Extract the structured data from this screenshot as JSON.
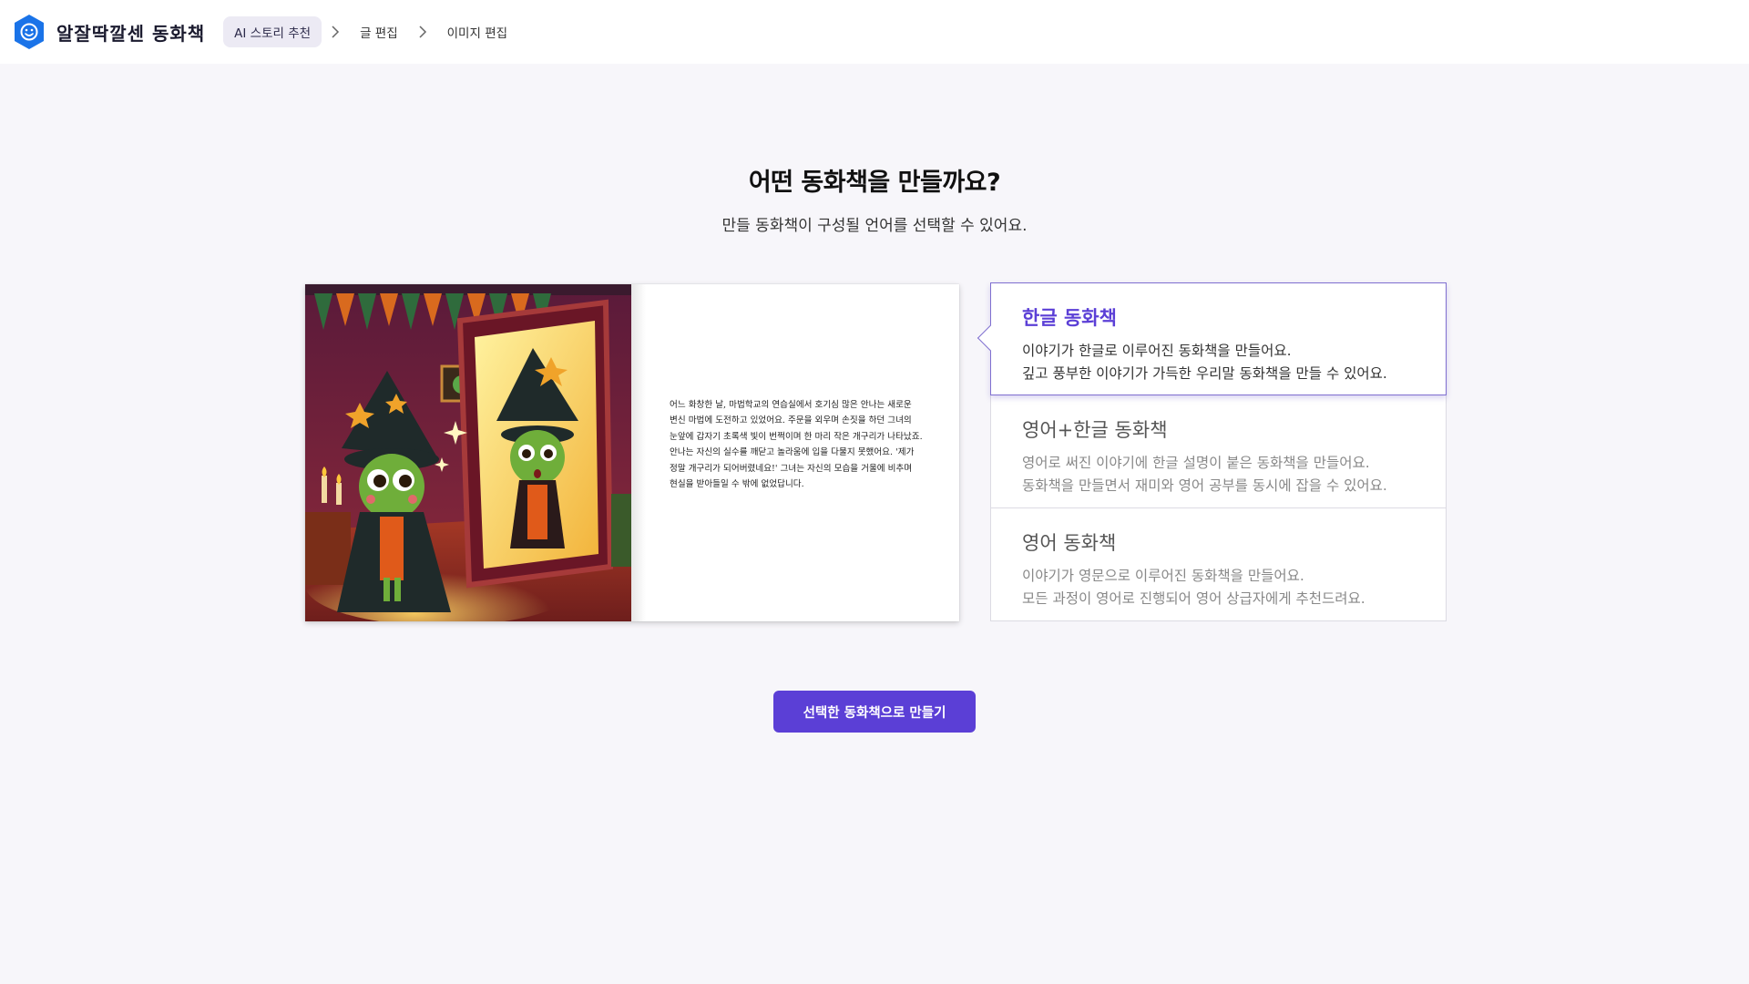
{
  "app": {
    "name": "알잘딱깔센 동화책",
    "logo_icon": "smiley-hexagon-icon",
    "brand_color": "#1a73e8"
  },
  "breadcrumb": [
    {
      "label": "AI 스토리 추천",
      "active": true
    },
    {
      "label": "글 편집",
      "active": false
    },
    {
      "label": "이미지 편집",
      "active": false
    }
  ],
  "heading": {
    "title": "어떤 동화책을 만들까요?",
    "subtitle": "만들 동화책이 구성될 언어를 선택할 수 있어요."
  },
  "preview": {
    "illustration_icon": "frog-witch-mirror-illustration",
    "text": "어느 화창한 날, 마법학교의 연습실에서 호기심 많은 안나는 새로운 변신 마법에 도전하고 있었어요. 주문을 외우며 손짓을 하던 그녀의 눈앞에 갑자기 초록색 빛이 번쩍이며 한 마리 작은 개구리가 나타났죠. 안나는 자신의 실수를 깨닫고 놀라움에 입을 다물지 못했어요. '제가 정말 개구리가 되어버렸네요!' 그녀는 자신의 모습을 거울에 비추며 현실을 받아들일 수 밖에 없었답니다."
  },
  "options": [
    {
      "title": "한글 동화책",
      "desc_line1": "이야기가 한글로 이루어진 동화책을 만들어요.",
      "desc_line2": "깊고 풍부한 이야기가 가득한 우리말 동화책을 만들 수 있어요.",
      "selected": true
    },
    {
      "title": "영어+한글 동화책",
      "desc_line1": "영어로 써진 이야기에 한글 설명이 붙은 동화책을 만들어요.",
      "desc_line2": "동화책을 만들면서 재미와 영어 공부를 동시에 잡을 수 있어요.",
      "selected": false
    },
    {
      "title": "영어 동화책",
      "desc_line1": "이야기가 영문으로 이루어진 동화책을 만들어요.",
      "desc_line2": "모든 과정이 영어로 진행되어 영어 상급자에게 추천드려요.",
      "selected": false
    }
  ],
  "actions": {
    "create_label": "선택한 동화책으로 만들기"
  },
  "colors": {
    "accent": "#5b3fd6",
    "selected_border": "#7f6fd0",
    "background": "#f7f6fa"
  }
}
